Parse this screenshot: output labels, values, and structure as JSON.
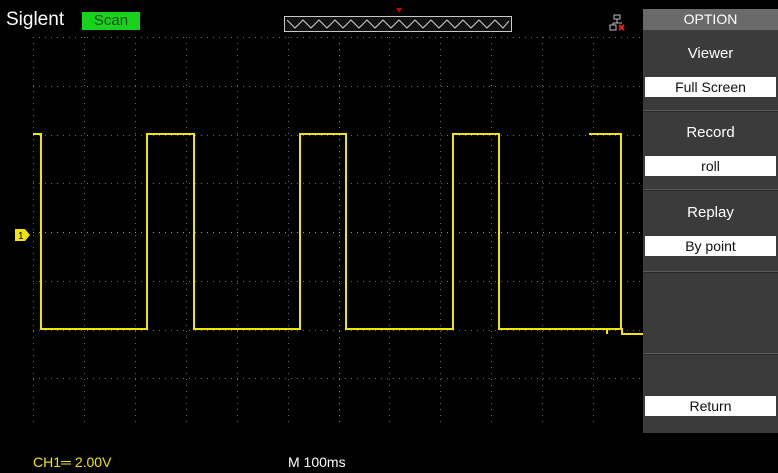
{
  "header": {
    "brand": "Siglent",
    "run_state": "Scan"
  },
  "icons": {
    "trigger_position": "trigger-position-marker",
    "network": "network-disconnected-icon",
    "channel_marker": "channel-1-ground-marker"
  },
  "colors": {
    "run_state_bg": "#19d21b",
    "channel1": "#f2e600",
    "menu_bg": "#3b3b3b"
  },
  "status": {
    "channel": "CH1═ 2.00V",
    "timebase": "M 100ms"
  },
  "channel_marker_label": "1",
  "menu": {
    "title": "OPTION",
    "viewer_label": "Viewer",
    "viewer_value": "Full Screen",
    "record_label": "Record",
    "record_value": "roll",
    "replay_label": "Replay",
    "replay_value": "By point",
    "return_label": "Return"
  }
}
